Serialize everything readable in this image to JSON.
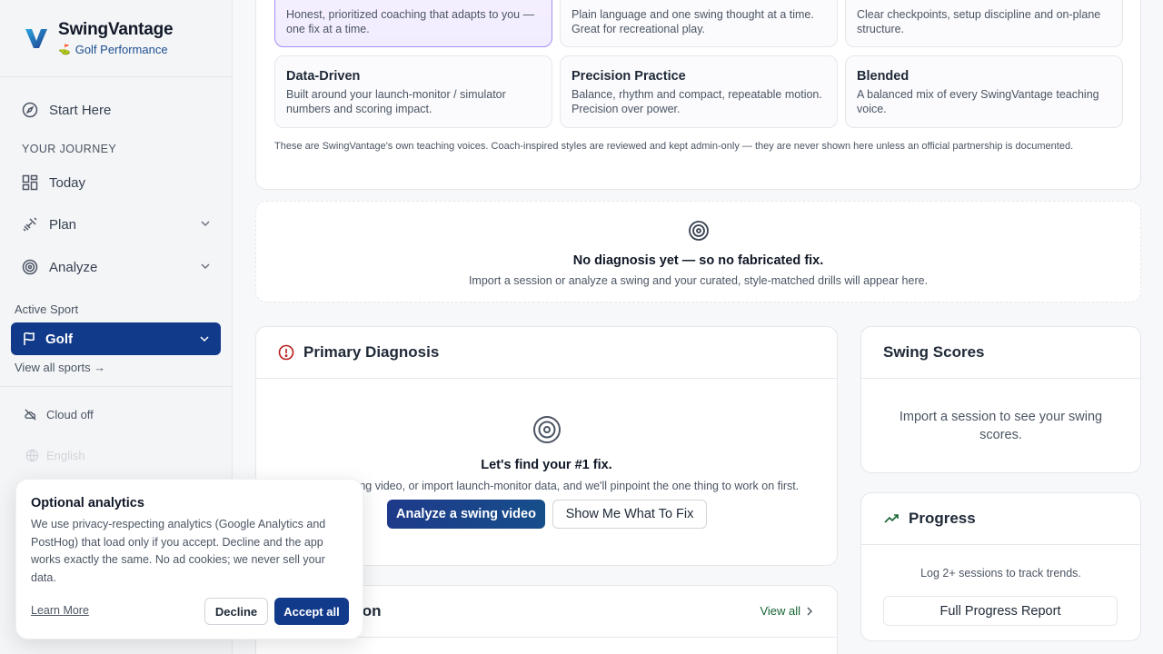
{
  "brand": {
    "name": "SwingVantage",
    "subtitle": "Golf Performance"
  },
  "sidebar": {
    "start_here": "Start Here",
    "section_journey": "YOUR JOURNEY",
    "today": "Today",
    "plan": "Plan",
    "analyze": "Analyze",
    "active_sport_label": "Active Sport",
    "active_sport": "Golf",
    "view_all_sports": "View all sports →",
    "cloud": "Cloud off",
    "language": "English"
  },
  "styles": {
    "top": [
      {
        "desc": "Honest, prioritized coaching that adapts to you — one fix at a time."
      },
      {
        "desc": "Plain language and one swing thought at a time. Great for recreational play."
      },
      {
        "desc": "Clear checkpoints, setup discipline and on-plane structure."
      }
    ],
    "bottom": [
      {
        "title": "Data-Driven",
        "desc": "Built around your launch-monitor / simulator numbers and scoring impact."
      },
      {
        "title": "Precision Practice",
        "desc": "Balance, rhythm and compact, repeatable motion. Precision over power."
      },
      {
        "title": "Blended",
        "desc": "A balanced mix of every SwingVantage teaching voice."
      }
    ],
    "note": "These are SwingVantage's own teaching voices. Coach-inspired styles are reviewed and kept admin-only — they are never shown here unless an official partnership is documented."
  },
  "no_diagnosis": {
    "title": "No diagnosis yet — so no fabricated fix.",
    "text": "Import a session or analyze a swing and your curated, style-matched drills will appear here."
  },
  "primary_diagnosis": {
    "title": "Primary Diagnosis",
    "heading": "Let's find your #1 fix.",
    "text": "Upload a swing video, or import launch-monitor data, and we'll pinpoint the one thing to work on first.",
    "analyze_button": "Analyze a swing video",
    "show_button": "Show Me What To Fix"
  },
  "swing_scores": {
    "title": "Swing Scores",
    "text": "Import a session to see your swing scores."
  },
  "progress": {
    "title": "Progress",
    "text": "Log 2+ sessions to track trends.",
    "button": "Full Progress Report"
  },
  "session_card": {
    "title_partial": "ion",
    "view_all": "View all"
  },
  "cookie": {
    "title": "Optional analytics",
    "text": "We use privacy-respecting analytics (Google Analytics and PostHog) that load only if you accept. Decline and the app works exactly the same. No ad cookies; we never sell your data.",
    "learn_more": "Learn More",
    "decline": "Decline",
    "accept": "Accept all"
  }
}
